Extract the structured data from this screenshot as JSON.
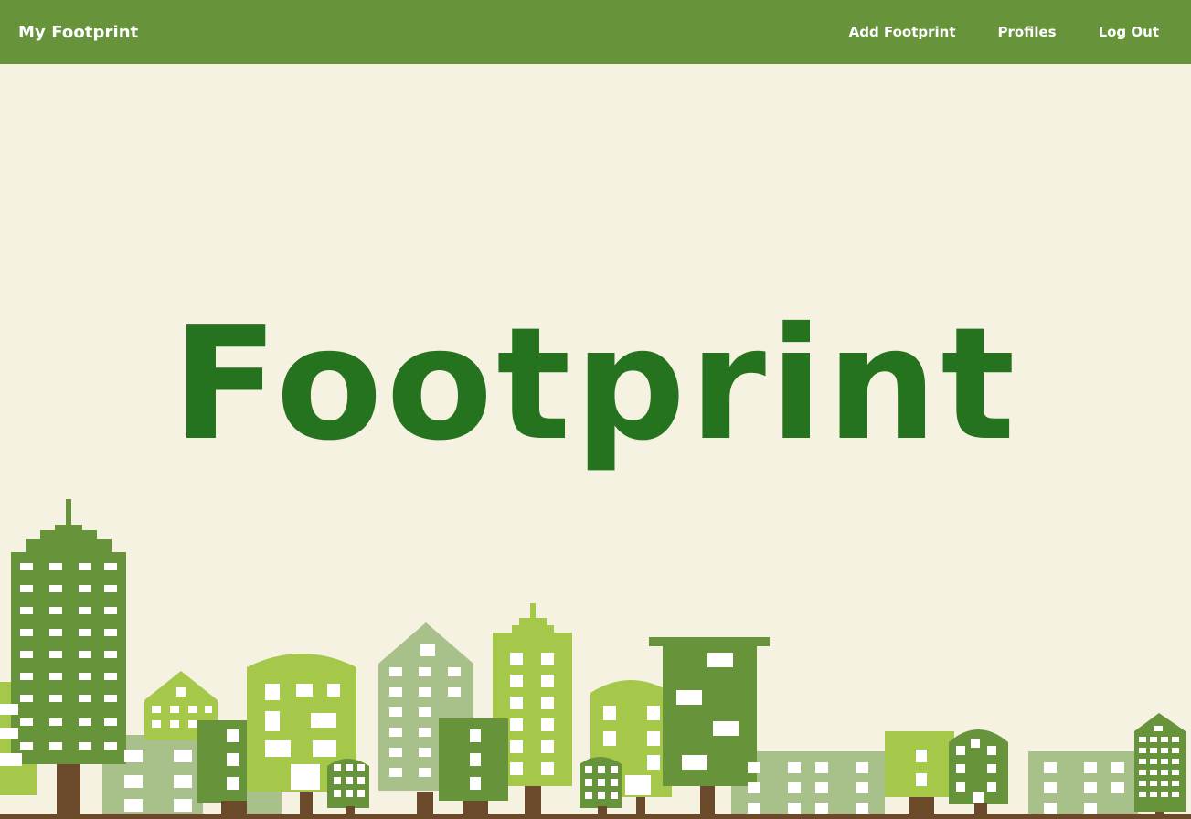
{
  "navbar": {
    "brand": "My Footprint",
    "links": [
      {
        "label": "Add Footprint"
      },
      {
        "label": "Profiles"
      },
      {
        "label": "Log Out"
      }
    ]
  },
  "hero": {
    "title": "Footprint"
  },
  "colors": {
    "navbar_bg": "#67943b",
    "page_bg": "#f6f2e1",
    "title": "#25721f",
    "dark_green": "#67943b",
    "light_green": "#a5c84a",
    "sage": "#a8c08a",
    "trunk": "#6b4a2b"
  }
}
